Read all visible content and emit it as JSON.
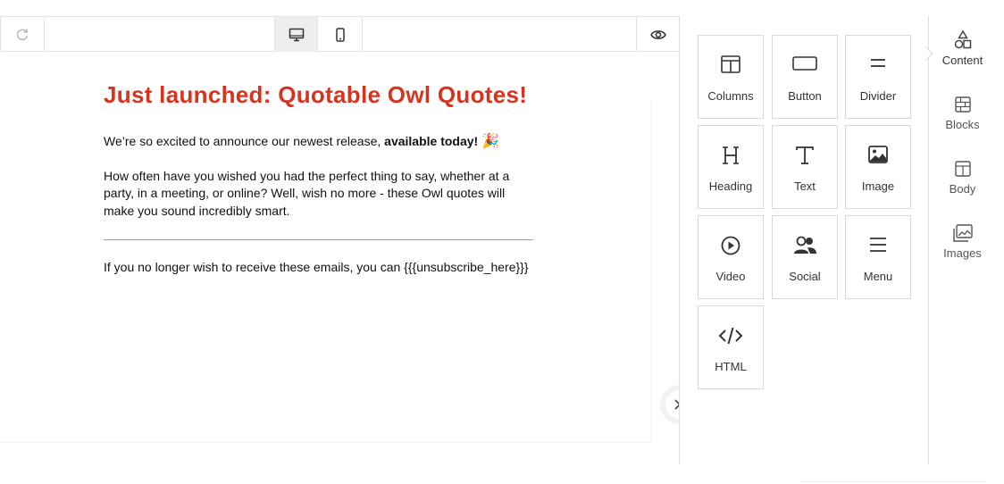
{
  "toolbar": {
    "redo_icon": "redo-icon",
    "desktop_icon": "desktop-icon",
    "mobile_icon": "mobile-icon",
    "preview_icon": "eye-icon"
  },
  "email": {
    "headline": "Just launched: Quotable Owl Quotes!",
    "p1_text": "We’re so excited to announce our newest release, ",
    "p1_bold": "available today!",
    "p1_emoji": "🎉",
    "p2": "How often have you wished you had the perfect thing to say, whether at a party, in a meeting, or online? Well, wish no more - these Owl quotes will make you sound incredibly smart.",
    "p3": "If you no longer wish to receive these emails, you can {{{unsubscribe_here}}}"
  },
  "tools": [
    {
      "label": "Columns",
      "icon": "columns-icon"
    },
    {
      "label": "Button",
      "icon": "button-icon"
    },
    {
      "label": "Divider",
      "icon": "divider-icon"
    },
    {
      "label": "Heading",
      "icon": "heading-icon"
    },
    {
      "label": "Text",
      "icon": "text-icon"
    },
    {
      "label": "Image",
      "icon": "image-icon"
    },
    {
      "label": "Video",
      "icon": "video-icon"
    },
    {
      "label": "Social",
      "icon": "social-icon"
    },
    {
      "label": "Menu",
      "icon": "menu-icon"
    },
    {
      "label": "HTML",
      "icon": "html-icon"
    }
  ],
  "tabs": [
    {
      "label": "Content",
      "icon": "shapes-icon",
      "active": true
    },
    {
      "label": "Blocks",
      "icon": "blocks-icon"
    },
    {
      "label": "Body",
      "icon": "body-icon"
    },
    {
      "label": "Images",
      "icon": "images-icon"
    }
  ],
  "colors": {
    "headline": "#d7331f",
    "active_device_bg": "#eeeeee",
    "border": "#d9d9d9"
  }
}
